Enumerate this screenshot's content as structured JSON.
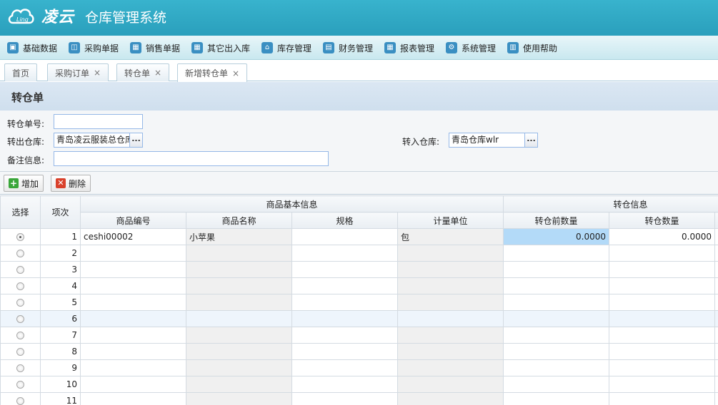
{
  "header": {
    "brand": "凌云",
    "logo_text": "Ling",
    "title": "仓库管理系统"
  },
  "menu": [
    {
      "label": "基础数据",
      "icon": "cube-icon"
    },
    {
      "label": "采购单据",
      "icon": "basket-icon"
    },
    {
      "label": "销售单据",
      "icon": "calendar-icon"
    },
    {
      "label": "其它出入库",
      "icon": "calendar-icon"
    },
    {
      "label": "库存管理",
      "icon": "home-icon"
    },
    {
      "label": "财务管理",
      "icon": "wallet-icon"
    },
    {
      "label": "报表管理",
      "icon": "calendar-icon"
    },
    {
      "label": "系统管理",
      "icon": "gear-icon"
    },
    {
      "label": "使用帮助",
      "icon": "book-icon"
    }
  ],
  "tabs": [
    {
      "label": "首页",
      "closable": false
    },
    {
      "label": "采购订单",
      "closable": true
    },
    {
      "label": "转仓单",
      "closable": true
    },
    {
      "label": "新增转仓单",
      "closable": true
    }
  ],
  "close_glyph": "×",
  "page": {
    "title": "转仓单"
  },
  "form": {
    "order_no_label": "转仓单号:",
    "order_no_value": "",
    "from_label": "转出仓库:",
    "from_value": "青岛凌云服装总仓库",
    "to_label": "转入仓库:",
    "to_value": "青岛仓库wlr",
    "remark_label": "备注信息:",
    "remark_value": "",
    "picker_glyph": "..."
  },
  "toolbar": {
    "add_label": "增加",
    "delete_label": "删除"
  },
  "grid": {
    "group_basic": "商品基本信息",
    "group_transfer": "转仓信息",
    "col_select": "选择",
    "col_index": "项次",
    "columns": [
      "商品编号",
      "商品名称",
      "规格",
      "计量单位",
      "转仓前数量",
      "转仓数量"
    ],
    "rows": [
      {
        "index": "1",
        "code": "ceshi00002",
        "name": "小苹果",
        "spec": "",
        "unit": "包",
        "before_qty": "0.0000",
        "qty": "0.0000",
        "selected": true
      },
      {
        "index": "2",
        "code": "",
        "name": "",
        "spec": "",
        "unit": "",
        "before_qty": "",
        "qty": ""
      },
      {
        "index": "3",
        "code": "",
        "name": "",
        "spec": "",
        "unit": "",
        "before_qty": "",
        "qty": ""
      },
      {
        "index": "4",
        "code": "",
        "name": "",
        "spec": "",
        "unit": "",
        "before_qty": "",
        "qty": ""
      },
      {
        "index": "5",
        "code": "",
        "name": "",
        "spec": "",
        "unit": "",
        "before_qty": "",
        "qty": ""
      },
      {
        "index": "6",
        "code": "",
        "name": "",
        "spec": "",
        "unit": "",
        "before_qty": "",
        "qty": "",
        "hover": true
      },
      {
        "index": "7",
        "code": "",
        "name": "",
        "spec": "",
        "unit": "",
        "before_qty": "",
        "qty": ""
      },
      {
        "index": "8",
        "code": "",
        "name": "",
        "spec": "",
        "unit": "",
        "before_qty": "",
        "qty": ""
      },
      {
        "index": "9",
        "code": "",
        "name": "",
        "spec": "",
        "unit": "",
        "before_qty": "",
        "qty": ""
      },
      {
        "index": "10",
        "code": "",
        "name": "",
        "spec": "",
        "unit": "",
        "before_qty": "",
        "qty": ""
      },
      {
        "index": "11",
        "code": "",
        "name": "",
        "spec": "",
        "unit": "",
        "before_qty": "",
        "qty": ""
      }
    ]
  }
}
